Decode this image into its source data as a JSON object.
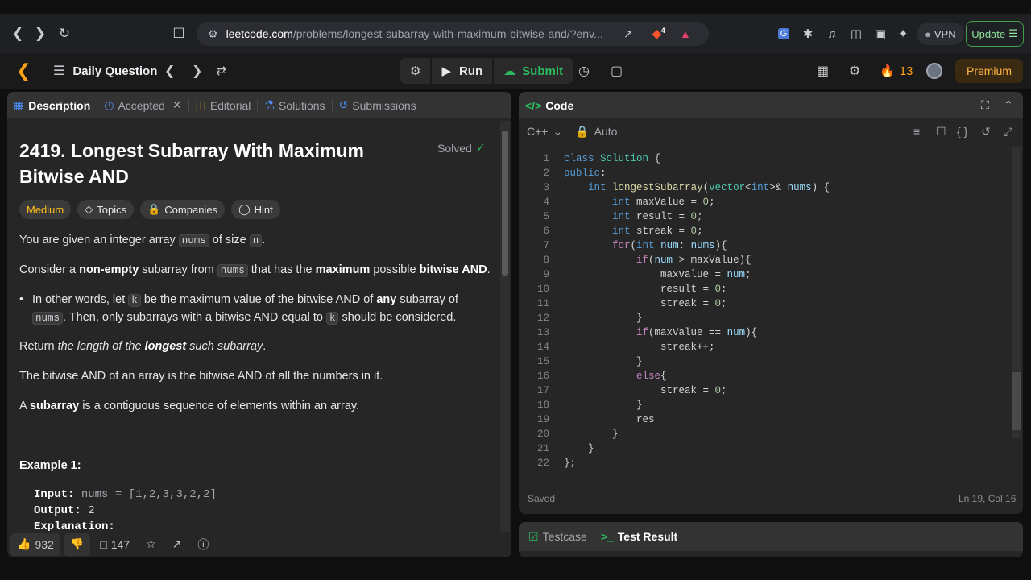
{
  "browser": {
    "url_host": "leetcode.com",
    "url_path": "/problems/longest-subarray-with-maximum-bitwise-and/?env...",
    "brave_badge": "4",
    "vpn_label": "VPN",
    "update_label": "Update"
  },
  "topbar": {
    "daily_question": "Daily Question",
    "run_label": "Run",
    "submit_label": "Submit",
    "streak_count": "13",
    "premium_label": "Premium"
  },
  "left_tabs": {
    "description": "Description",
    "accepted": "Accepted",
    "editorial": "Editorial",
    "solutions": "Solutions",
    "submissions": "Submissions"
  },
  "problem": {
    "title": "2419. Longest Subarray With Maximum Bitwise AND",
    "status": "Solved",
    "difficulty": "Medium",
    "chips": [
      "Topics",
      "Companies",
      "Hint"
    ],
    "p1_a": "You are given an integer array ",
    "p1_code1": "nums",
    "p1_b": " of size ",
    "p1_code2": "n",
    "p1_c": ".",
    "p2_a": "Consider a ",
    "p2_b1": "non-empty",
    "p2_c": " subarray from ",
    "p2_code": "nums",
    "p2_d": " that has the ",
    "p2_b2": "maximum",
    "p2_e": " possible ",
    "p2_b3": "bitwise AND",
    "p2_f": ".",
    "bullet_a": "In other words, let ",
    "bullet_code1": "k",
    "bullet_b": " be the maximum value of the bitwise AND of ",
    "bullet_bold": "any",
    "bullet_c": " subarray of",
    "bullet_code2": "nums",
    "bullet_d": ". Then, only subarrays with a bitwise AND equal to ",
    "bullet_code3": "k",
    "bullet_e": " should be considered.",
    "p3_a": "Return ",
    "p3_i1": "the length of the ",
    "p3_bi": "longest",
    "p3_i2": " such subarray",
    "p3_b": ".",
    "p4": "The bitwise AND of an array is the bitwise AND of all the numbers in it.",
    "p5_a": "A ",
    "p5_bold": "subarray",
    "p5_b": " is a contiguous sequence of elements within an array.",
    "example_title": "Example 1:",
    "input_label": "Input:",
    "input_value": "nums = [1,2,3,3,2,2]",
    "output_label": "Output:",
    "output_value": "2",
    "explanation_label": "Explanation:"
  },
  "left_footer": {
    "likes": "932",
    "comments": "147"
  },
  "code_panel": {
    "title": "Code",
    "language": "C++",
    "mode": "Auto",
    "saved": "Saved",
    "cursor_pos": "Ln 19, Col 16"
  },
  "code_lines": [
    "class Solution {",
    "public:",
    "    int longestSubarray(vector<int>& nums) {",
    "        int maxValue = 0;",
    "        int result = 0;",
    "        int streak = 0;",
    "        for(int num: nums){",
    "            if(num > maxValue){",
    "                maxvalue = num;",
    "                result = 0;",
    "                streak = 0;",
    "            }",
    "            if(maxValue == num){",
    "                streak++;",
    "            }",
    "            else{",
    "                streak = 0;",
    "            }",
    "            res",
    "        }",
    "    }",
    "};"
  ],
  "bottom_tabs": {
    "testcase": "Testcase",
    "test_result": "Test Result"
  },
  "icons": {
    "accent_green": "#2cbb5d",
    "accent_orange": "#ffa116",
    "medium_color": "#ffc01e"
  }
}
